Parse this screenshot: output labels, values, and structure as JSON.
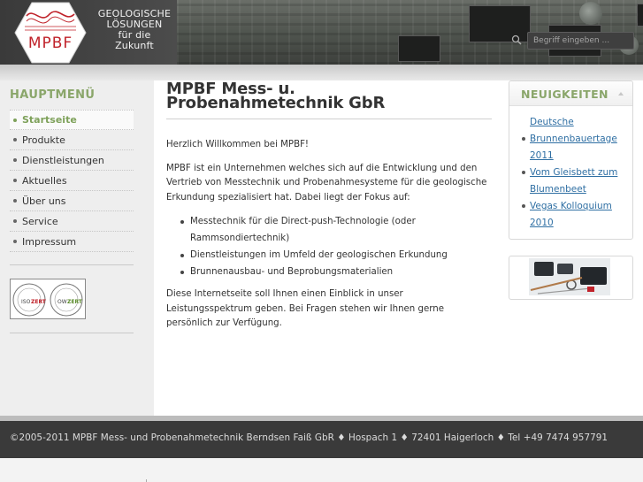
{
  "header": {
    "logo_text": "MPBF",
    "tagline": "GEOLOGISCHE LÖSUNGEN für die Zukunft",
    "tagline_lines": [
      "GEOLOGISCHE",
      "LÖSUNGEN",
      "für die",
      "Zukunft"
    ],
    "search": {
      "placeholder": "Begriff eingeben ..."
    }
  },
  "sidebar": {
    "title": "HAUPTMENÜ",
    "items": [
      {
        "label": "Startseite",
        "active": true
      },
      {
        "label": "Produkte"
      },
      {
        "label": "Dienstleistungen"
      },
      {
        "label": "Aktuelles"
      },
      {
        "label": "Über uns"
      },
      {
        "label": "Service"
      },
      {
        "label": "Impressum"
      }
    ],
    "cert_labels": [
      "ISO",
      "ZERT",
      "OW",
      "ZERT"
    ]
  },
  "main": {
    "title": "MPBF Mess- u. Probenahmetechnik GbR",
    "title_lines": [
      "MPBF Mess- u.",
      "Probenahmetechnik GbR"
    ],
    "welcome": "Herzlich Willkommen bei MPBF!",
    "intro": "MPBF ist ein Unternehmen welches sich auf die Entwicklung und den Vertrieb von Messtechnik und Probenahmesysteme für die geologische Erkundung spezialisiert hat. Dabei liegt der Fokus auf:",
    "features": [
      "Messtechnik für die Direct-push-Technologie (oder Rammsondiertechnik)",
      "Dienstleistungen im Umfeld der geologischen Erkundung",
      "Brunnenausbau- und Beprobungsmaterialien"
    ],
    "outro": "Diese Internetseite soll Ihnen einen Einblick in unser Leistungsspektrum geben. Bei Fragen stehen wir Ihnen gerne persönlich zur Verfügung."
  },
  "news": {
    "title": "NEUIGKEITEN",
    "items": [
      {
        "label": "Deutsche Brunnenbauertage 2011",
        "lines": [
          "Deutsche",
          "Brunnenbauertage",
          "2011"
        ]
      },
      {
        "label": "Vom Gleisbett zum Blumenbeet",
        "lines": [
          "Vom Gleisbett zum",
          "Blumenbeet"
        ]
      },
      {
        "label": "Vegas Kolloquium 2010",
        "lines": [
          "Vegas Kolloquium",
          "2010"
        ]
      }
    ]
  },
  "footer": {
    "text": "©2005-2011 MPBF Mess- und Probenahmetechnik Berndsen Faiß GbR ♦ Hospach 1 ♦ 72401 Haigerloch ♦ Tel +49 7474 957791"
  },
  "colors": {
    "accent_green": "#8aa66a",
    "link_blue": "#2f6fa3",
    "header_dark": "#3a3a3a",
    "logo_red": "#c0222a"
  }
}
